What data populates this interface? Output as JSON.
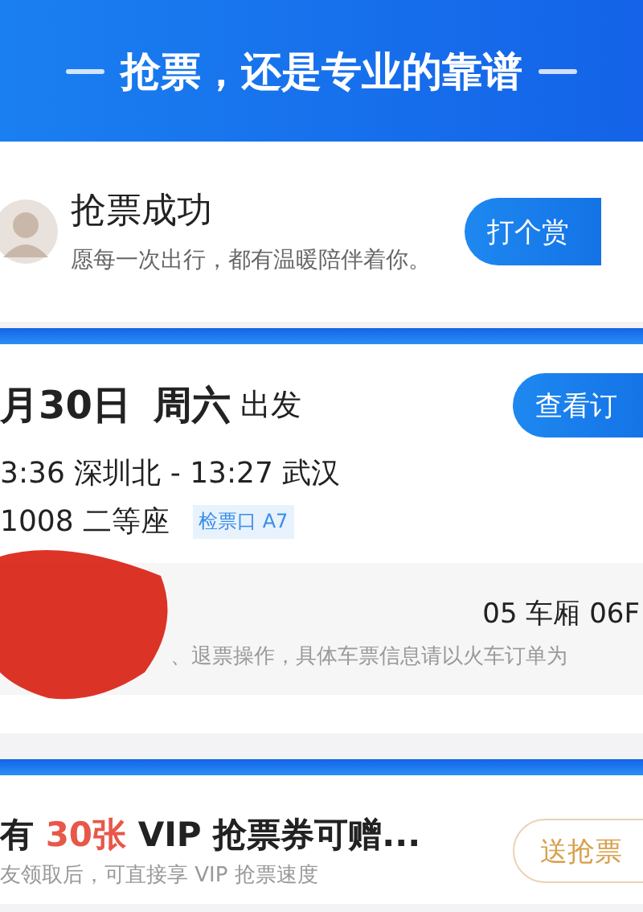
{
  "banner": {
    "title": "抢票，还是专业的靠谱"
  },
  "success": {
    "title": "抢票成功",
    "message": "愿每一次出行，都有温暖陪伴着你。",
    "button": "打个赏"
  },
  "order": {
    "date": "月30日",
    "weekday": "周六",
    "suffix": "出发",
    "button": "查看订",
    "route": "3:36 深圳北 - 13:27 武汉",
    "train": "1008 二等座",
    "gate": "检票口 A7",
    "passenger": {
      "seat": "05 车厢 06F",
      "note": "、退票操作，具体车票信息请以火车订单为",
      "redacted": true
    }
  },
  "coupon": {
    "title": "有 **30张** VIP 抢票券可赠...",
    "subtitle": "友领取后，可直接享 VIP 抢票速度",
    "button": "送抢票"
  }
}
